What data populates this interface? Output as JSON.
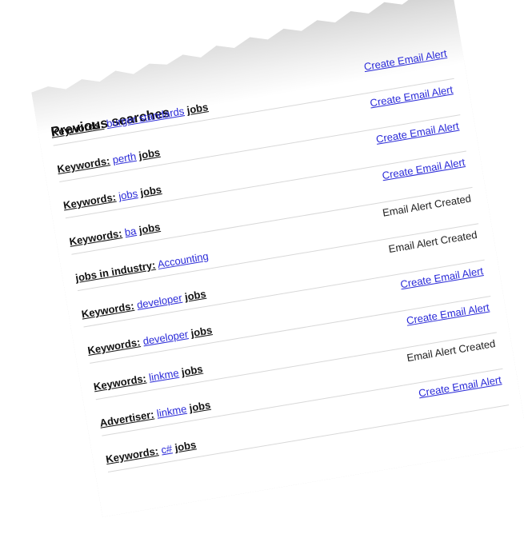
{
  "section_title": "Previous searches",
  "rows": [
    {
      "label": "Keywords:",
      "value": "burger standards",
      "suffix": "jobs",
      "action": "Create Email Alert",
      "action_state": "link"
    },
    {
      "label": "Keywords:",
      "value": "perth",
      "suffix": "jobs",
      "action": "Create Email Alert",
      "action_state": "link"
    },
    {
      "label": "Keywords:",
      "value": "jobs",
      "suffix": "jobs",
      "action": "Create Email Alert",
      "action_state": "link"
    },
    {
      "label": "Keywords:",
      "value": "ba",
      "suffix": "jobs",
      "action": "Create Email Alert",
      "action_state": "link"
    },
    {
      "label": "jobs in industry:",
      "value": "Accounting",
      "suffix": "",
      "action": "Email Alert Created",
      "action_state": "done"
    },
    {
      "label": "Keywords:",
      "value": "developer",
      "suffix": "jobs",
      "action": "Email Alert Created",
      "action_state": "done"
    },
    {
      "label": "Keywords:",
      "value": "developer",
      "suffix": "jobs",
      "action": "Create Email Alert",
      "action_state": "link"
    },
    {
      "label": "Keywords:",
      "value": "linkme",
      "suffix": "jobs",
      "action": "Create Email Alert",
      "action_state": "link"
    },
    {
      "label": "Advertiser:",
      "value": "linkme",
      "suffix": "jobs",
      "action": "Email Alert Created",
      "action_state": "done"
    },
    {
      "label": "Keywords:",
      "value": "c#",
      "suffix": "jobs",
      "action": "Create Email Alert",
      "action_state": "link"
    }
  ],
  "colors": {
    "link": "#2a2ad8",
    "text": "#111111",
    "divider": "#d8d8d8"
  }
}
